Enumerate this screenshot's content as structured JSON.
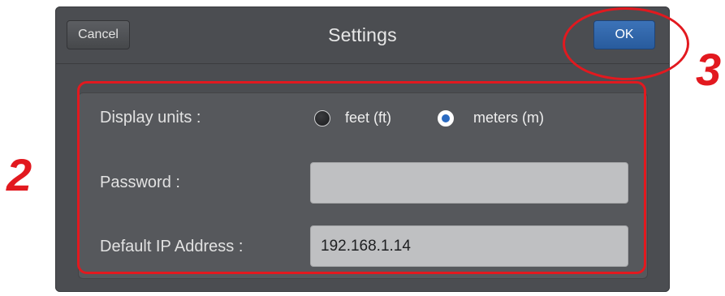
{
  "dialog": {
    "title": "Settings",
    "cancel_label": "Cancel",
    "ok_label": "OK"
  },
  "form": {
    "display_units": {
      "label": "Display units :",
      "options": [
        {
          "label": "feet (ft)",
          "selected": false
        },
        {
          "label": "meters (m)",
          "selected": true
        }
      ]
    },
    "password": {
      "label": "Password :",
      "value": ""
    },
    "default_ip": {
      "label": "Default IP Address :",
      "value": "192.168.1.14"
    }
  },
  "annotations": {
    "callout_2": "2",
    "callout_3": "3",
    "color": "#e2191f"
  },
  "colors": {
    "dialog_bg": "#4b4d51",
    "panel_bg": "#56585c",
    "ok_button": "#2f66ab",
    "field_bg": "#bfc0c2",
    "radio_selected": "#2a6ac1"
  }
}
